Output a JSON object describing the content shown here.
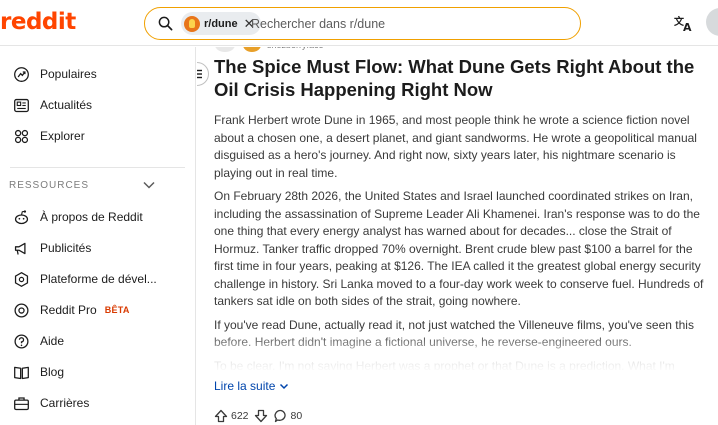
{
  "header": {
    "logo_text": "reddit",
    "subreddit_chip": "r/dune",
    "chip_close": "✕",
    "search_placeholder": "Rechercher dans r/dune"
  },
  "sidebar": {
    "items_top": [
      {
        "label": "Populaires",
        "icon": "trending-arrow-icon"
      },
      {
        "label": "Actualités",
        "icon": "news-icon"
      },
      {
        "label": "Explorer",
        "icon": "explore-icon"
      }
    ],
    "resources_title": "RESSOURCES",
    "items_resources": [
      {
        "label": "À propos de Reddit",
        "icon": "reddit-alien-icon"
      },
      {
        "label": "Publicités",
        "icon": "megaphone-icon"
      },
      {
        "label": "Plateforme de dével...",
        "icon": "developer-platform-icon"
      },
      {
        "label": "Reddit Pro",
        "icon": "pro-icon",
        "badge": "BÊTA"
      },
      {
        "label": "Aide",
        "icon": "help-icon"
      },
      {
        "label": "Blog",
        "icon": "blog-icon"
      },
      {
        "label": "Carrières",
        "icon": "briefcase-icon"
      }
    ]
  },
  "post": {
    "author": "snozberryface",
    "title": "The Spice Must Flow: What Dune Gets Right About the Oil Crisis Happening Right Now",
    "paragraphs": [
      "Frank Herbert wrote Dune in 1965, and most people think he wrote a science fiction novel about a chosen one, a desert planet, and giant sandworms. He wrote a geopolitical manual disguised as a hero's journey. And right now, sixty years later, his nightmare scenario is playing out in real time.",
      "On February 28th 2026, the United States and Israel launched coordinated strikes on Iran, including the assassination of Supreme Leader Ali Khamenei. Iran's response was to do the one thing that every energy analyst has warned about for decades... close the Strait of Hormuz. Tanker traffic dropped 70% overnight. Brent crude blew past $100 a barrel for the first time in four years, peaking at $126. The IEA called it the greatest global energy security challenge in history. Sri Lanka moved to a four-day work week to conserve fuel. Hundreds of tankers sat idle on both sides of the strait, going nowhere.",
      "If you've read Dune, actually read it, not just watched the Villeneuve films, you've seen this before. Herbert didn't imagine a fictional universe, he reverse-engineered ours.",
      "To be clear, I'm not saying Herbert was a prophet or that Dune is a prediction. What I'm saying is that Herbert identified the structural logic of resource chokepoint warfare in 1965, and that logic is now playing out with eerie precision. The parallels aren't coincidence, they're the result of a novelist who understood systems better than most analysts."
    ],
    "read_more": "Lire la suite",
    "upvotes": "622",
    "comments": "80"
  },
  "colors": {
    "brand": "#ff4500",
    "search_border": "#f0a000",
    "link": "#0045ac",
    "beta": "#d93a00"
  }
}
